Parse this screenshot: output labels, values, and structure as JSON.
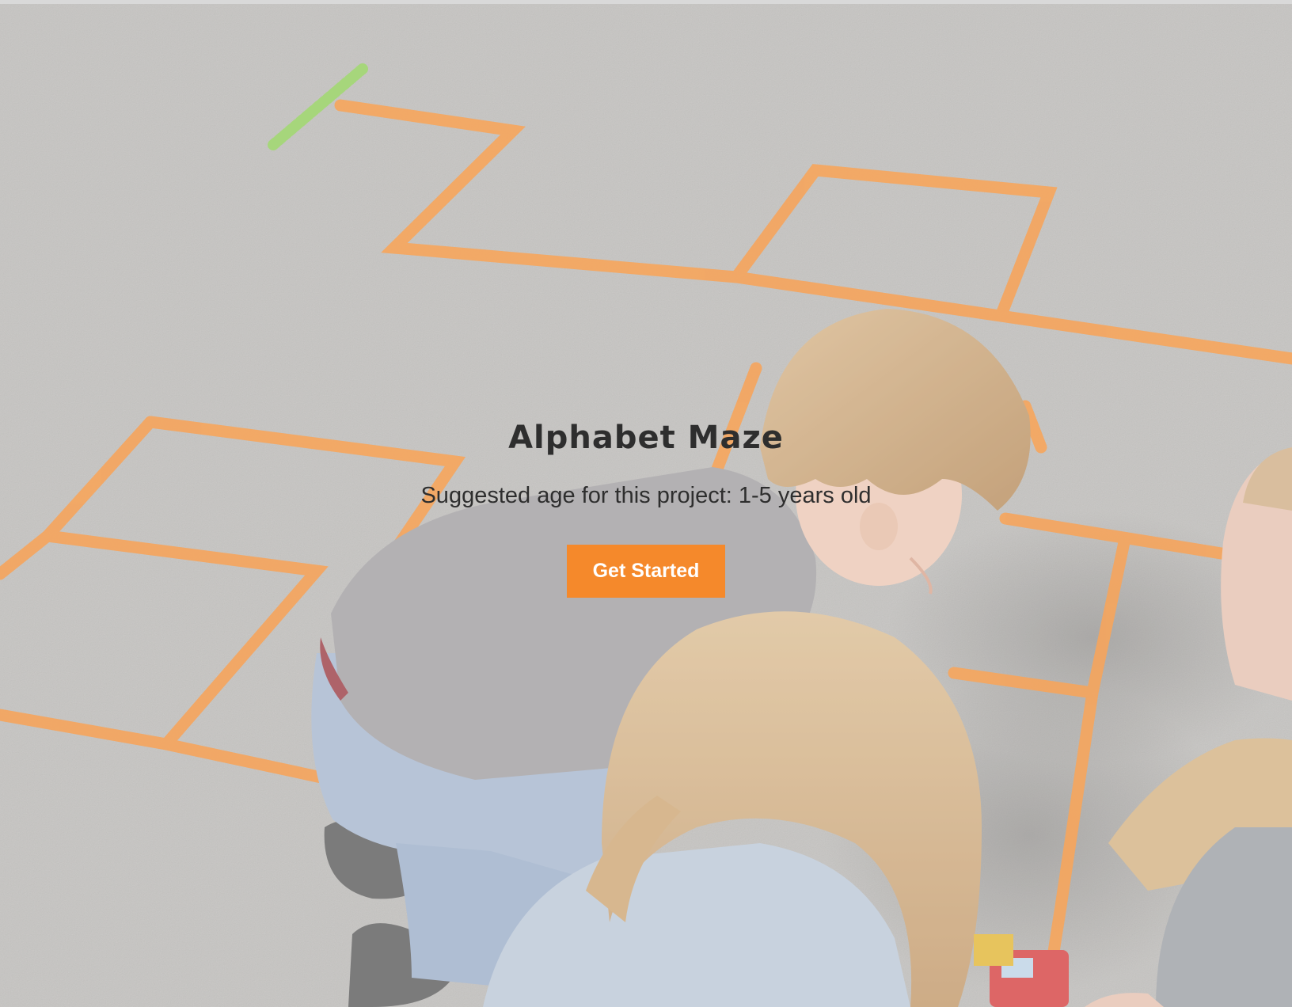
{
  "hero": {
    "title": "Alphabet Maze",
    "subtitle": "Suggested age for this project: 1-5 years old",
    "cta_label": "Get Started"
  },
  "colors": {
    "accent": "#f5892b",
    "asphalt": "#b9b7b4",
    "maze_line": "#f3923c",
    "text": "#2e2e2e"
  }
}
